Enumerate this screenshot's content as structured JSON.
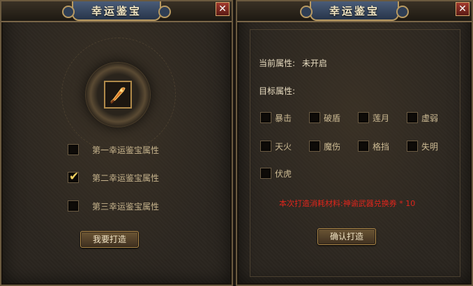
{
  "left_panel": {
    "title": "幸运鉴宝",
    "close_label": "✕",
    "options": [
      {
        "label": "第一幸运鉴宝属性",
        "checked": false
      },
      {
        "label": "第二幸运鉴宝属性",
        "checked": true
      },
      {
        "label": "第三幸运鉴宝属性",
        "checked": false
      }
    ],
    "check_mark": "✔",
    "forge_button": "我要打造"
  },
  "right_panel": {
    "title": "幸运鉴宝",
    "close_label": "✕",
    "current_attr_label": "当前属性:",
    "current_attr_value": "未开启",
    "target_attr_label": "目标属性:",
    "attributes": [
      "暴击",
      "破盾",
      "莲月",
      "虚弱",
      "天火",
      "魔伤",
      "格挡",
      "失明",
      "伏虎"
    ],
    "cost_text": "本次打造消耗材料:神谕武器兑换券 * 10",
    "confirm_button": "确认打造"
  },
  "colors": {
    "panel_bg": "#2b2620",
    "border_gold": "#b08a4a",
    "title_blue": "#3a4a66",
    "cost_red": "#e0251c",
    "tick_yellow": "#f0d060"
  },
  "icons": {
    "emblem": "sword-item-icon",
    "close": "close-icon",
    "check": "checkmark-icon"
  }
}
